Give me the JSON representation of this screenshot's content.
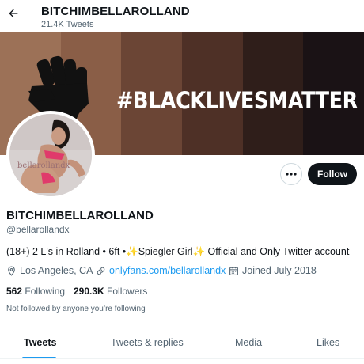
{
  "header": {
    "title": "BITCHIMBELLAROLLAND",
    "tweet_count": "21.4K Tweets"
  },
  "banner": {
    "text": "#BLACKLIVESMATTER",
    "stripe_colors": [
      "#9c7157",
      "#8a5e47",
      "#6b4535",
      "#4e3026",
      "#2f1e1a",
      "#1a1215"
    ]
  },
  "avatar": {
    "watermark": "bellarollandx"
  },
  "actions": {
    "follow_label": "Follow"
  },
  "profile": {
    "display_name": "BITCHIMBELLAROLLAND",
    "handle": "@bellarollandx",
    "bio": "(18+) 2 L's in Rolland • 6ft •✨Spiegler Girl✨ Official and Only Twitter account",
    "location": "Los Angeles, CA",
    "website": "onlyfans.com/bellarollandx",
    "joined": "Joined July 2018"
  },
  "stats": {
    "following_count": "562",
    "following_label": "Following",
    "followers_count": "290.3K",
    "followers_label": "Followers"
  },
  "followed_by": "Not followed by anyone you’re following",
  "tabs": [
    {
      "label": "Tweets",
      "active": true
    },
    {
      "label": "Tweets & replies",
      "active": false
    },
    {
      "label": "Media",
      "active": false
    },
    {
      "label": "Likes",
      "active": false
    }
  ],
  "colors": {
    "accent": "#1d9bf0",
    "text": "#0f1419",
    "muted": "#536471"
  }
}
